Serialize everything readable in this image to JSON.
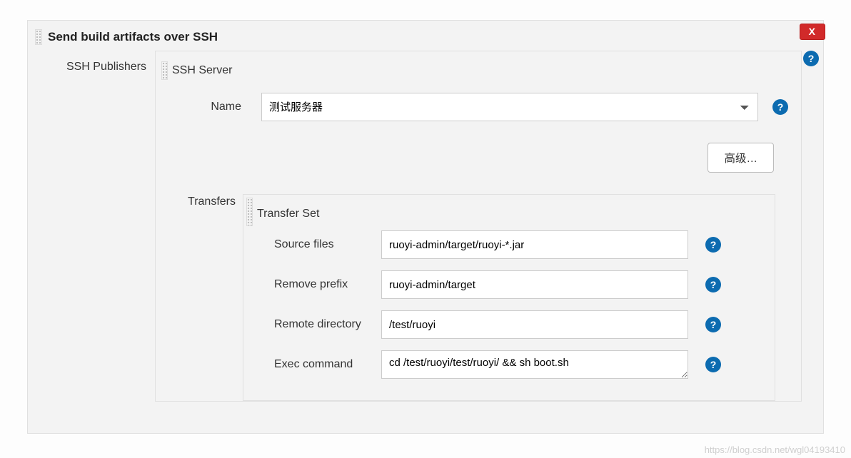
{
  "header": {
    "title": "Send build artifacts over SSH",
    "close_label": "X"
  },
  "labels": {
    "ssh_publishers": "SSH Publishers",
    "ssh_server": "SSH Server",
    "name": "Name",
    "advanced": "高级…",
    "transfers": "Transfers",
    "transfer_set": "Transfer Set",
    "source_files": "Source files",
    "remove_prefix": "Remove prefix",
    "remote_directory": "Remote directory",
    "exec_command": "Exec command"
  },
  "fields": {
    "name_selected": "测试服务器",
    "source_files": "ruoyi-admin/target/ruoyi-*.jar",
    "remove_prefix": "ruoyi-admin/target",
    "remote_directory": "/test/ruoyi",
    "exec_command": "cd /test/ruoyi/test/ruoyi/ && sh boot.sh"
  },
  "watermark": "https://blog.csdn.net/wgl04193410"
}
